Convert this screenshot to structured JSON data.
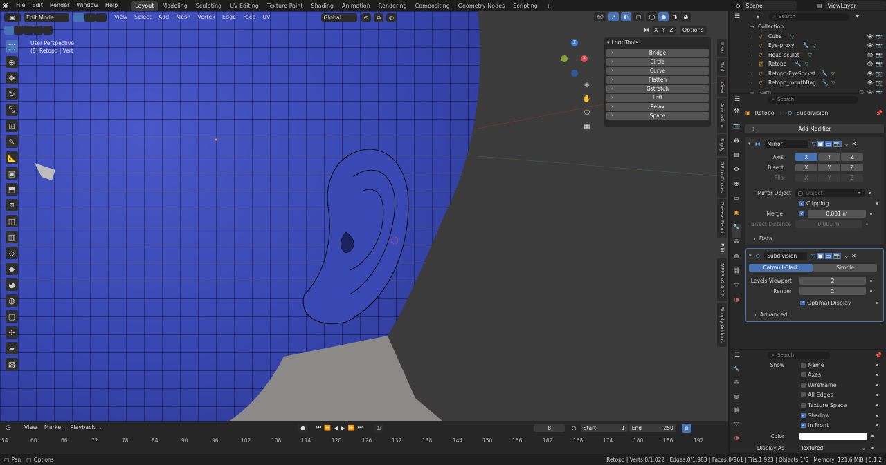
{
  "topbar": {
    "menus": [
      "File",
      "Edit",
      "Render",
      "Window",
      "Help"
    ],
    "workspaces": [
      "Layout",
      "Modeling",
      "Sculpting",
      "UV Editing",
      "Texture Paint",
      "Shading",
      "Animation",
      "Rendering",
      "Compositing",
      "Geometry Nodes",
      "Scripting"
    ],
    "add_tab": "+",
    "scene": "Scene",
    "view_layer": "ViewLayer"
  },
  "viewport": {
    "mode": "Edit Mode",
    "menus": [
      "View",
      "Select",
      "Add",
      "Mesh",
      "Vertex",
      "Edge",
      "Face",
      "UV"
    ],
    "orientation": "Global",
    "perspective": "User Perspective",
    "object_info": "(8) Retopo | Vert",
    "axis_labels": [
      "X",
      "Y",
      "Z"
    ],
    "options_label": "Options",
    "gizmo": {
      "x": "X",
      "y": "Y",
      "z": "Z"
    },
    "side_tabs": [
      "Item",
      "Tool",
      "View",
      "Animation",
      "Rigify",
      "GP to Curves",
      "Grease Pencil",
      "Edit",
      "MPFB v2.0.12",
      "Simply Addons"
    ]
  },
  "looptools": {
    "title": "LoopTools",
    "buttons": [
      "Bridge",
      "Circle",
      "Curve",
      "Flatten",
      "Gstretch",
      "Loft",
      "Relax",
      "Space"
    ]
  },
  "outliner": {
    "search_placeholder": "Search",
    "collection": "Collection",
    "items": [
      "Cube",
      "Eye-proxy",
      "Head-sculpt",
      "Retopo",
      "Retopo-EyeSocket",
      "Retopo_mouthBag",
      "cam"
    ]
  },
  "properties": {
    "search_placeholder": "Search",
    "breadcrumb_object": "Retopo",
    "breadcrumb_modifier": "Subdivision",
    "add_modifier": "Add Modifier",
    "mirror": {
      "name": "Mirror",
      "axis_label": "Axis",
      "bisect_label": "Bisect",
      "flip_label": "Flip",
      "axes": [
        "X",
        "Y",
        "Z"
      ],
      "mirror_object_label": "Mirror Object",
      "object_placeholder": "Object",
      "clipping_label": "Clipping",
      "merge_label": "Merge",
      "merge_value": "0.001 m",
      "bisect_distance_label": "Bisect Distance",
      "bisect_distance_value": "0.001 m",
      "data_label": "Data"
    },
    "subdivision": {
      "name": "Subdivision",
      "catmull": "Catmull-Clark",
      "simple": "Simple",
      "levels_viewport_label": "Levels Viewport",
      "levels_viewport_value": "2",
      "render_label": "Render",
      "render_value": "2",
      "optimal_display_label": "Optimal Display",
      "advanced_label": "Advanced"
    }
  },
  "viewport_display": {
    "search_placeholder": "Search",
    "show_label": "Show",
    "items": [
      {
        "label": "Name",
        "checked": false
      },
      {
        "label": "Axes",
        "checked": false
      },
      {
        "label": "Wireframe",
        "checked": false
      },
      {
        "label": "All Edges",
        "checked": false
      },
      {
        "label": "Texture Space",
        "checked": false
      },
      {
        "label": "Shadow",
        "checked": true
      },
      {
        "label": "In Front",
        "checked": true
      }
    ],
    "color_label": "Color",
    "display_as_label": "Display As",
    "display_as_value": "Textured"
  },
  "timeline": {
    "menus": [
      "View",
      "Marker",
      "Playback"
    ],
    "current_frame": "8",
    "start_label": "Start",
    "start_value": "1",
    "end_label": "End",
    "end_value": "250",
    "ticks": [
      "54",
      "60",
      "66",
      "72",
      "78",
      "84",
      "90",
      "96",
      "102",
      "108",
      "114",
      "120",
      "126",
      "132",
      "138",
      "144",
      "150",
      "156",
      "162",
      "168",
      "174",
      "180",
      "186",
      "192"
    ]
  },
  "statusbar": {
    "pan": "Pan",
    "options": "Options",
    "stats": "Retopo | Verts:0/1,022 | Edges:0/1,983 | Faces:0/961 | Tris:1,923 | Objects:1/6 | Memory: 121.6 MiB | 5.1.2"
  },
  "colors": {
    "accent": "#4772b3",
    "mesh_blue": "#3846b0",
    "background": "#3b3b3b"
  }
}
